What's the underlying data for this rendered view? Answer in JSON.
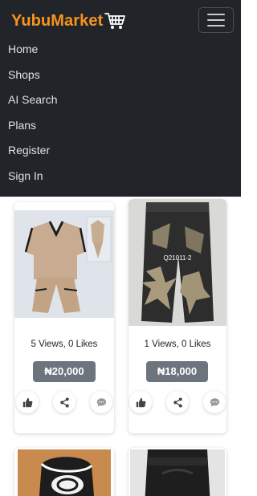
{
  "header": {
    "brand": "YubuMarket",
    "brand_color": "#f7941d",
    "nav_bg": "#212529",
    "cart_icon": "shopping-cart-icon",
    "menu_icon": "hamburger-icon",
    "nav_items": [
      "Home",
      "Shops",
      "AI Search",
      "Plans",
      "Register",
      "Sign In"
    ]
  },
  "products": [
    {
      "image_label": "",
      "stats": "5 Views, 0 Likes",
      "price": "₦20,000",
      "actions": [
        "thumbs-up-icon",
        "share-icon",
        "comment-icon"
      ]
    },
    {
      "image_label": "Q21011-2",
      "stats": "1 Views, 0 Likes",
      "price": "₦18,000",
      "actions": [
        "thumbs-up-icon",
        "share-icon",
        "comment-icon"
      ]
    }
  ]
}
